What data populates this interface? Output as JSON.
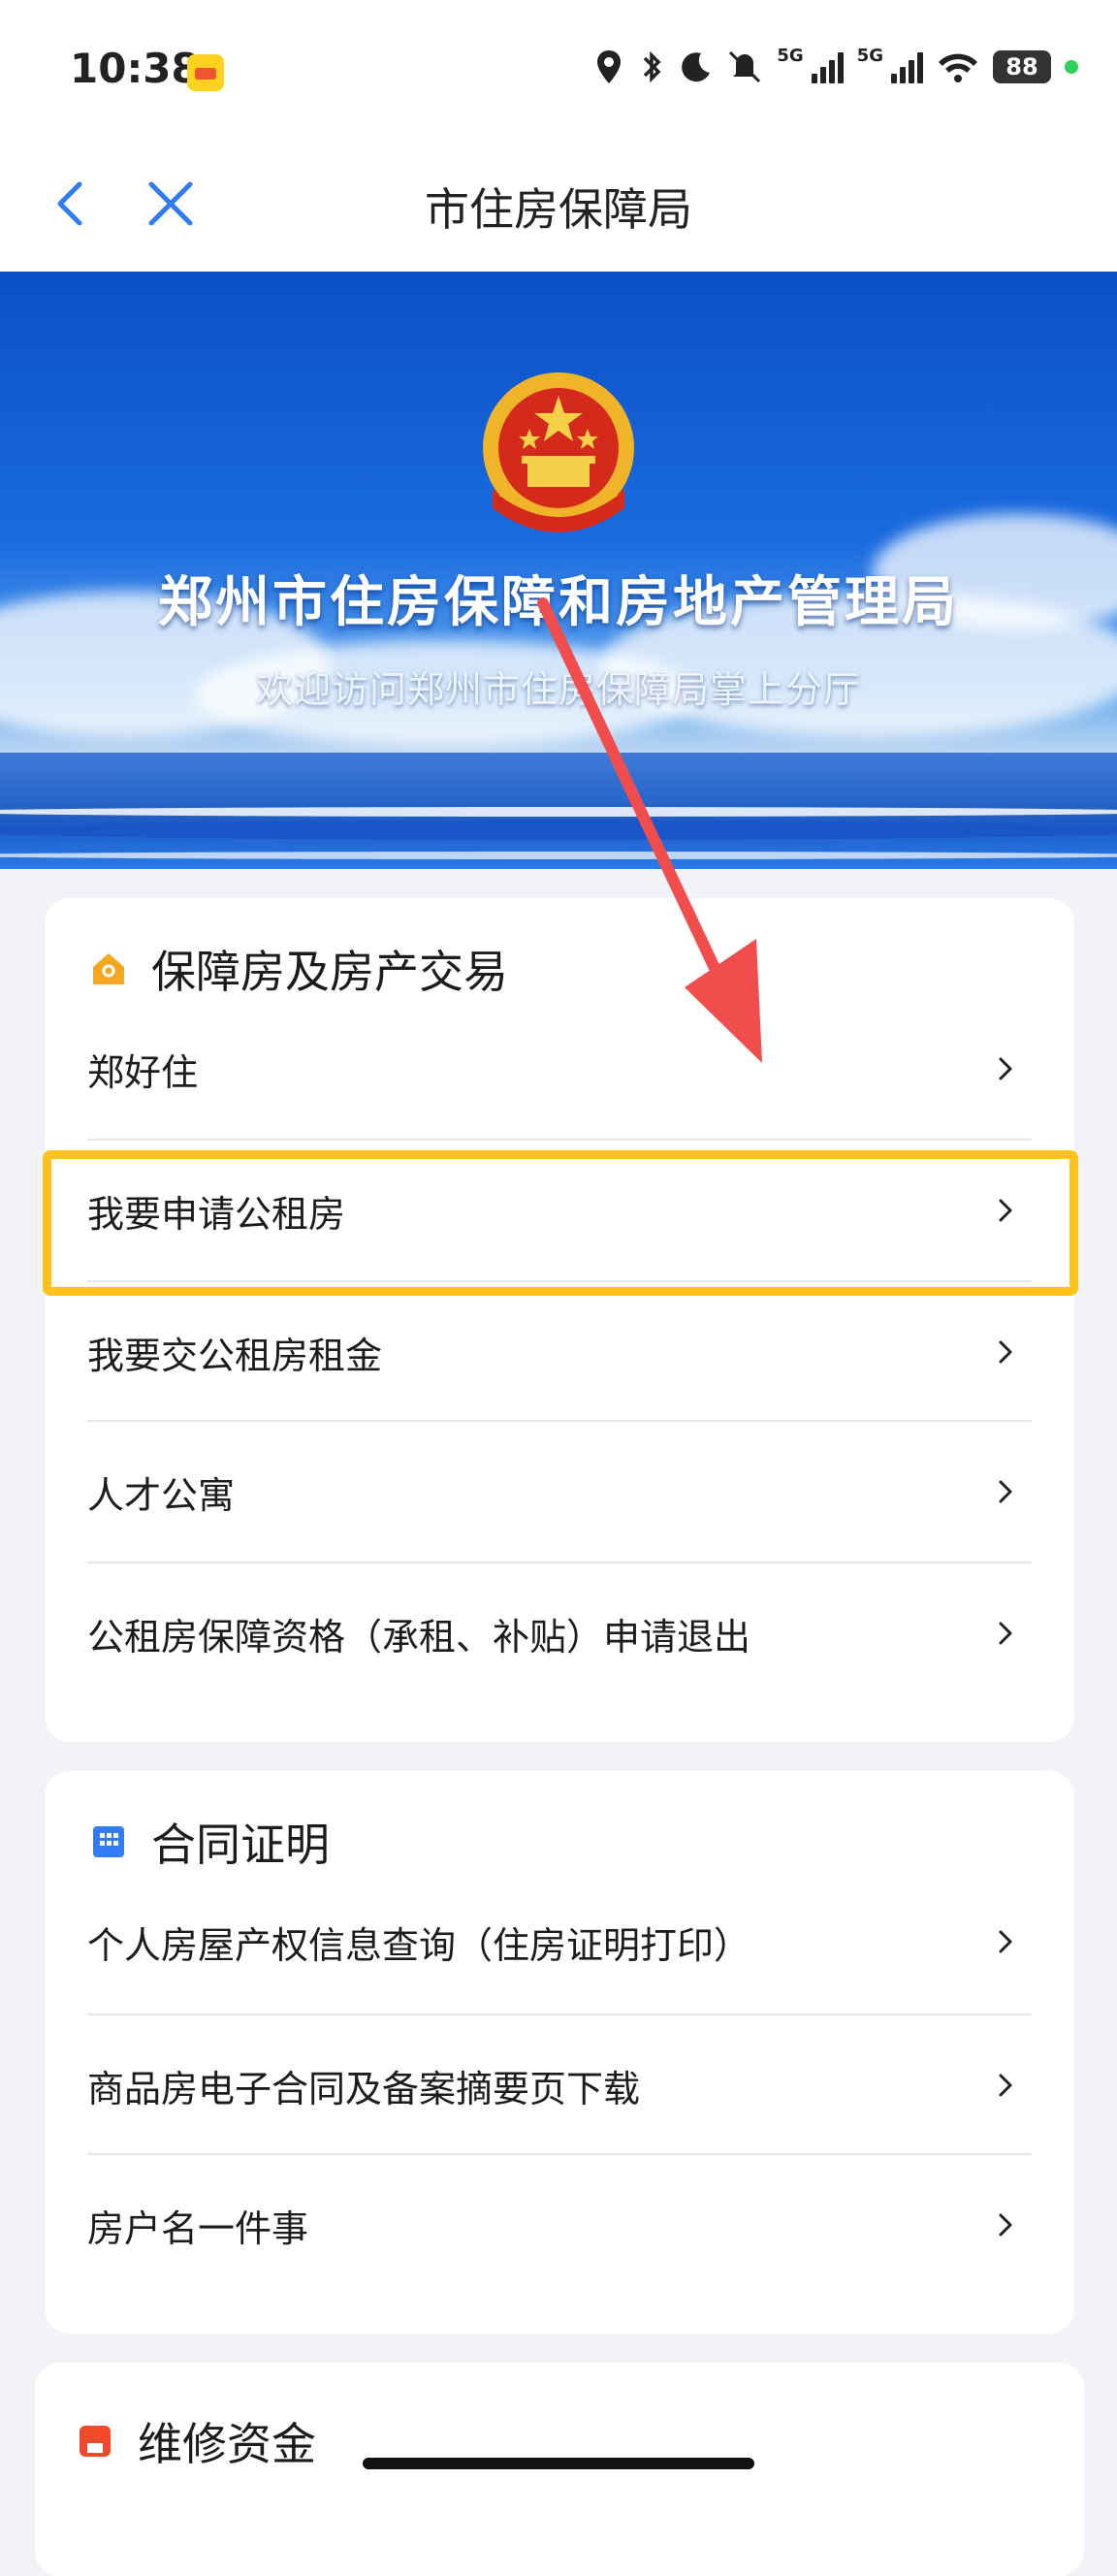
{
  "status_bar": {
    "time": "10:38",
    "network_1": "5G",
    "network_2": "5G",
    "battery": "88",
    "icons": [
      "location-icon",
      "bluetooth-icon",
      "moon-icon",
      "mute-icon",
      "signal-icon",
      "signal-icon",
      "wifi-icon",
      "battery-icon"
    ]
  },
  "nav": {
    "title": "市住房保障局",
    "back_icon": "chevron-left-icon",
    "close_icon": "close-icon"
  },
  "banner": {
    "title": "郑州市住房保障和房地产管理局",
    "subtitle": "欢迎访问郑州市住房保障局掌上分厅"
  },
  "sections": [
    {
      "title": "保障房及房产交易",
      "icon": "house-icon",
      "icon_color": "#f5a623",
      "items": [
        {
          "label": "郑好住"
        },
        {
          "label": "我要申请公租房"
        },
        {
          "label": "我要交公租房租金"
        },
        {
          "label": "人才公寓"
        },
        {
          "label": "公租房保障资格（承租、补贴）申请退出"
        }
      ]
    },
    {
      "title": "合同证明",
      "icon": "building-icon",
      "icon_color": "#2f7cf6",
      "items": [
        {
          "label": "个人房屋产权信息查询（住房证明打印）"
        },
        {
          "label": "商品房电子合同及备案摘要页下载"
        },
        {
          "label": "房户名一件事"
        }
      ]
    },
    {
      "title": "维修资金",
      "icon": "repair-icon",
      "icon_color": "#f04a2a",
      "items": []
    }
  ],
  "colors": {
    "highlight": "#ffc21a",
    "arrow": "#f24d4d",
    "banner_blue": "#1a6be0"
  }
}
